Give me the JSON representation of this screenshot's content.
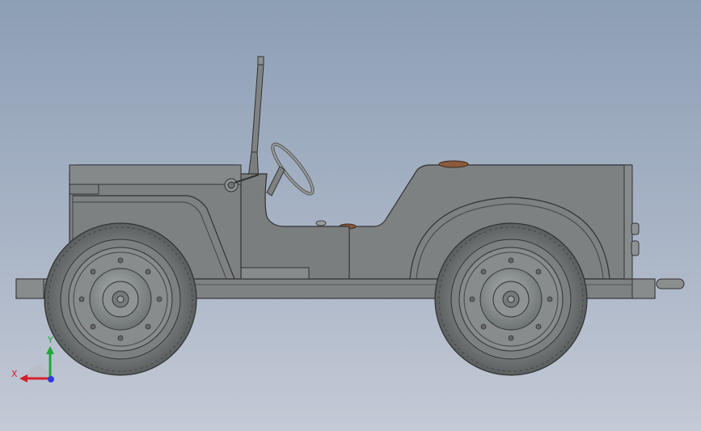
{
  "viewport": {
    "background_top": "#8d9fb5",
    "background_bottom": "#c4cad6",
    "model_name": "jeep",
    "body_color": "#7b7f7f",
    "tire_color": "#6d7171",
    "accent_color": "#8a5a3a"
  },
  "triad": {
    "x_label": "X",
    "y_label": "Y",
    "x_color": "#d4202a",
    "y_color": "#1fa83a",
    "z_color": "#2a3fd8"
  }
}
